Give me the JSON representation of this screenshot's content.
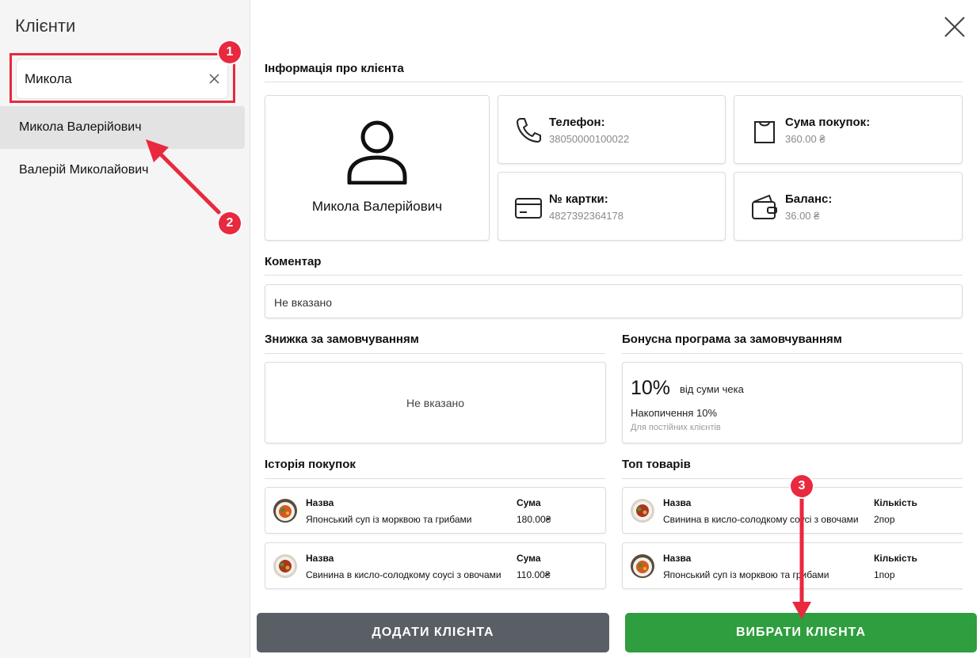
{
  "sidebar": {
    "title": "Клієнти",
    "search": {
      "value": "Микола",
      "placeholder": ""
    },
    "clients": [
      {
        "name": "Микола Валерійович",
        "selected": true
      },
      {
        "name": "Валерій Миколайович",
        "selected": false
      }
    ]
  },
  "client_info": {
    "section_title": "Інформація про клієнта",
    "name": "Микола Валерійович",
    "phone": {
      "label": "Телефон:",
      "value": "38050000100022"
    },
    "total": {
      "label": "Сума покупок:",
      "value": "360.00 ₴"
    },
    "card": {
      "label": "№ картки:",
      "value": "4827392364178"
    },
    "balance": {
      "label": "Баланс:",
      "value": "36.00 ₴"
    }
  },
  "comment": {
    "title": "Коментар",
    "value": "Не вказано"
  },
  "discount": {
    "title": "Знижка за замовчуванням",
    "value": "Не вказано"
  },
  "bonus": {
    "title": "Бонусна програма за замовчуванням",
    "percent": "10%",
    "of_text": "від суми чека",
    "accumulation": "Накопичення 10%",
    "note": "Для постійних клієнтів"
  },
  "history": {
    "title": "Історія покупок",
    "items": [
      {
        "name_label": "Назва",
        "name": "Японський суп із морквою та грибами",
        "sum_label": "Сума",
        "sum": "180.00₴",
        "thumb": "soup"
      },
      {
        "name_label": "Назва",
        "name": "Свинина в кисло-солодкому соусі з овочами",
        "sum_label": "Сума",
        "sum": "110.00₴",
        "thumb": "pork"
      }
    ]
  },
  "top_products": {
    "title": "Топ товарів",
    "items": [
      {
        "name_label": "Назва",
        "name": "Свинина в кисло-солодкому соусі з овочами",
        "qty_label": "Кількість",
        "qty": "2пор",
        "thumb": "pork"
      },
      {
        "name_label": "Назва",
        "name": "Японський суп із морквою та грибами",
        "qty_label": "Кількість",
        "qty": "1пор",
        "thumb": "soup"
      }
    ]
  },
  "buttons": {
    "add": "ДОДАТИ КЛІЄНТА",
    "select": "ВИБРАТИ КЛІЄНТА"
  },
  "annotations": {
    "markers": [
      "1",
      "2",
      "3"
    ]
  },
  "colors": {
    "annotation_red": "#e8293e",
    "select_button": "#2e9e3e",
    "add_button": "#5a5f66",
    "selected_row": "#e3e3e3"
  }
}
